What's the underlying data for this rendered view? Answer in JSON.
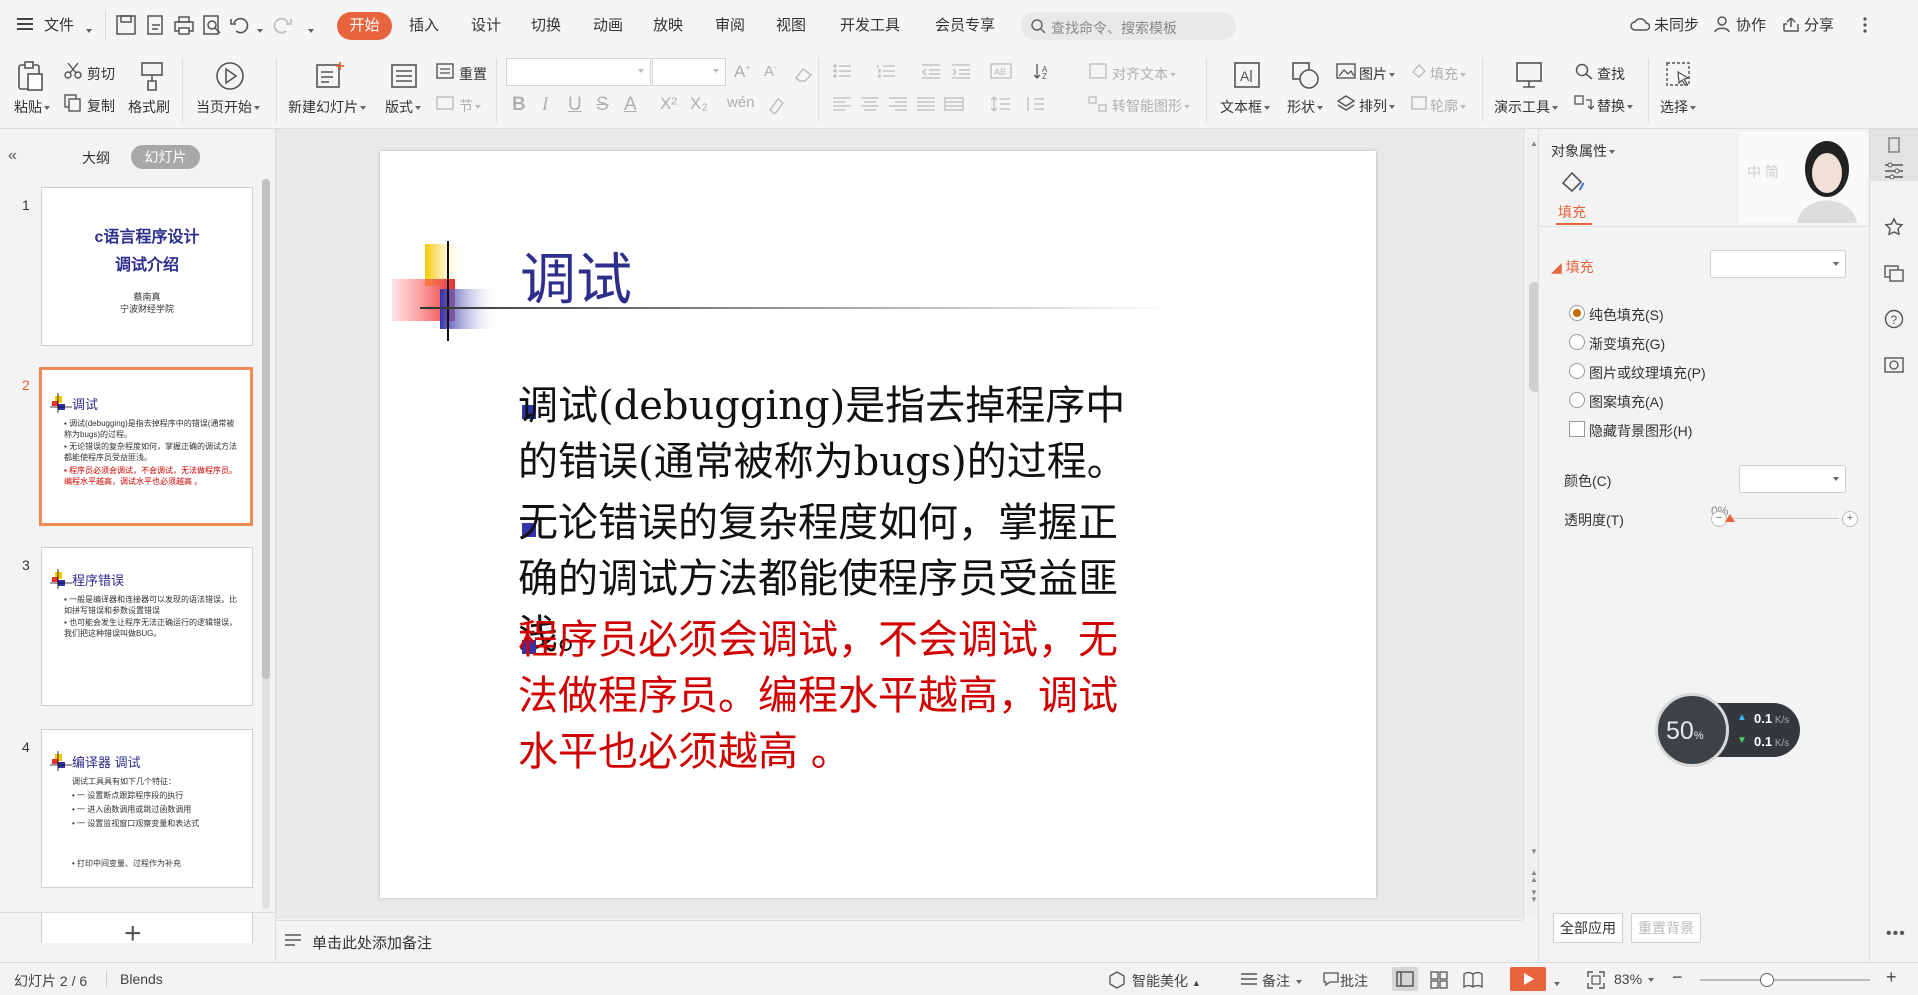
{
  "menu": {
    "file": "文件",
    "tabs": [
      "开始",
      "插入",
      "设计",
      "切换",
      "动画",
      "放映",
      "审阅",
      "视图",
      "开发工具",
      "会员专享"
    ],
    "active_tab": "开始",
    "search_placeholder": "查找命令、搜索模板",
    "sync": "未同步",
    "collab": "协作",
    "share": "分享"
  },
  "ribbon": {
    "paste": "粘贴",
    "cut": "剪切",
    "copy": "复制",
    "format_painter": "格式刷",
    "from_current": "当页开始",
    "new_slide": "新建幻灯片",
    "layout": "版式",
    "reset": "重置",
    "section": "节",
    "align_text": "对齐文本",
    "smart_shape": "转智能图形",
    "textbox": "文本框",
    "shape": "形状",
    "picture": "图片",
    "fill": "填充",
    "arrange": "排列",
    "outline": "轮廓",
    "present_tools": "演示工具",
    "find": "查找",
    "replace": "替换",
    "select": "选择",
    "font_letters": [
      "B",
      "I",
      "U",
      "S",
      "A",
      "X²",
      "X₂"
    ]
  },
  "left_panel": {
    "tab_outline": "大纲",
    "tab_slides": "幻灯片",
    "slides": [
      {
        "num": "1",
        "title": "c语言程序设计",
        "subtitle": "调试介绍",
        "author": "蔡南真",
        "org": "宁波财经学院"
      },
      {
        "num": "2",
        "title": "调试",
        "lines": [
          "调试(debugging)是指去掉程序中的错误(通常被称为bugs)的过程。",
          "无论错误的复杂程度如何，掌握正确的调试方法都能使程序员受益匪浅。"
        ],
        "red": "程序员必须会调试，不会调试，无法做程序员。编程水平越高，调试水平也必须越高 。"
      },
      {
        "num": "3",
        "title": "程序错误",
        "lines": [
          "一般是编译器和连接器可以发现的语法错误，比如拼写错误和参数设置错误",
          "也可能会发生让程序无法正确运行的逻辑错误，我们把这种错误叫做BUG。"
        ]
      },
      {
        "num": "4",
        "title": "编译器 调试",
        "intro": "调试工具具有如下几个特征：",
        "lines": [
          "一 设置断点跟踪程序段的执行",
          "一 进入函数调用或跳过函数调用",
          "一 设置监视窗口观察变量和表达式"
        ],
        "extra": "打印中间变量、过程作为补充"
      }
    ],
    "add": "+"
  },
  "slide": {
    "title": "调试",
    "bullets": [
      "调试(debugging)是指去掉程序中的错误(通常被称为bugs)的过程。",
      "无论错误的复杂程度如何，掌握正确的调试方法都能使程序员受益匪浅。",
      "程序员必须会调试，不会调试，无法做程序员。编程水平越高，调试水平也必须越高 。"
    ],
    "red_color": "#d10000",
    "title_color": "#2e2e8c"
  },
  "notes": {
    "placeholder": "单击此处添加备注"
  },
  "right_panel": {
    "header": "对象属性",
    "fill_tab": "填充",
    "fill_section": "填充",
    "options": [
      "纯色填充(S)",
      "渐变填充(G)",
      "图片或纹理填充(P)",
      "图案填充(A)"
    ],
    "hide_bg": "隐藏背景图形(H)",
    "color_label": "颜色(C)",
    "transparency_label": "透明度(T)",
    "transparency_value": "0%",
    "apply_all": "全部应用",
    "reset_bg": "重置背景"
  },
  "speed": {
    "percent": "50",
    "unit": "%",
    "up": "0.1",
    "down": "0.1",
    "rate_unit": "K/s"
  },
  "status": {
    "slide_pos": "幻灯片 2 / 6",
    "theme": "Blends",
    "beautify": "智能美化",
    "notes": "备注",
    "comments": "批注",
    "zoom": "83%",
    "minus": "−",
    "plus": "+"
  }
}
